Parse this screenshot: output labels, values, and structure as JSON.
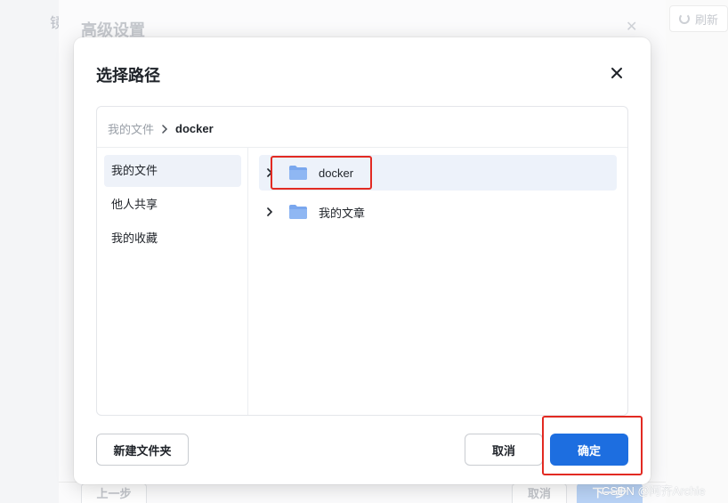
{
  "background": {
    "left_text": "镜",
    "title": "高级设置",
    "refresh_label": "刷新",
    "prev_label": "上一步",
    "cancel_label": "取消",
    "next_label": "下一步",
    "watermark": "CSDN @阿齐Archie"
  },
  "dialog": {
    "title": "选择路径",
    "breadcrumb": {
      "root": "我的文件",
      "current": "docker"
    },
    "sidebar": {
      "items": [
        {
          "label": "我的文件",
          "active": true
        },
        {
          "label": "他人共享",
          "active": false
        },
        {
          "label": "我的收藏",
          "active": false
        }
      ]
    },
    "folders": [
      {
        "name": "docker",
        "selected": true
      },
      {
        "name": "我的文章",
        "selected": false
      }
    ],
    "buttons": {
      "new_folder": "新建文件夹",
      "cancel": "取消",
      "confirm": "确定"
    }
  },
  "colors": {
    "primary": "#1d6ee0",
    "annotation_red": "#e22a22",
    "folder": "#7aa7ee",
    "selected_bg": "#edf2fa"
  }
}
